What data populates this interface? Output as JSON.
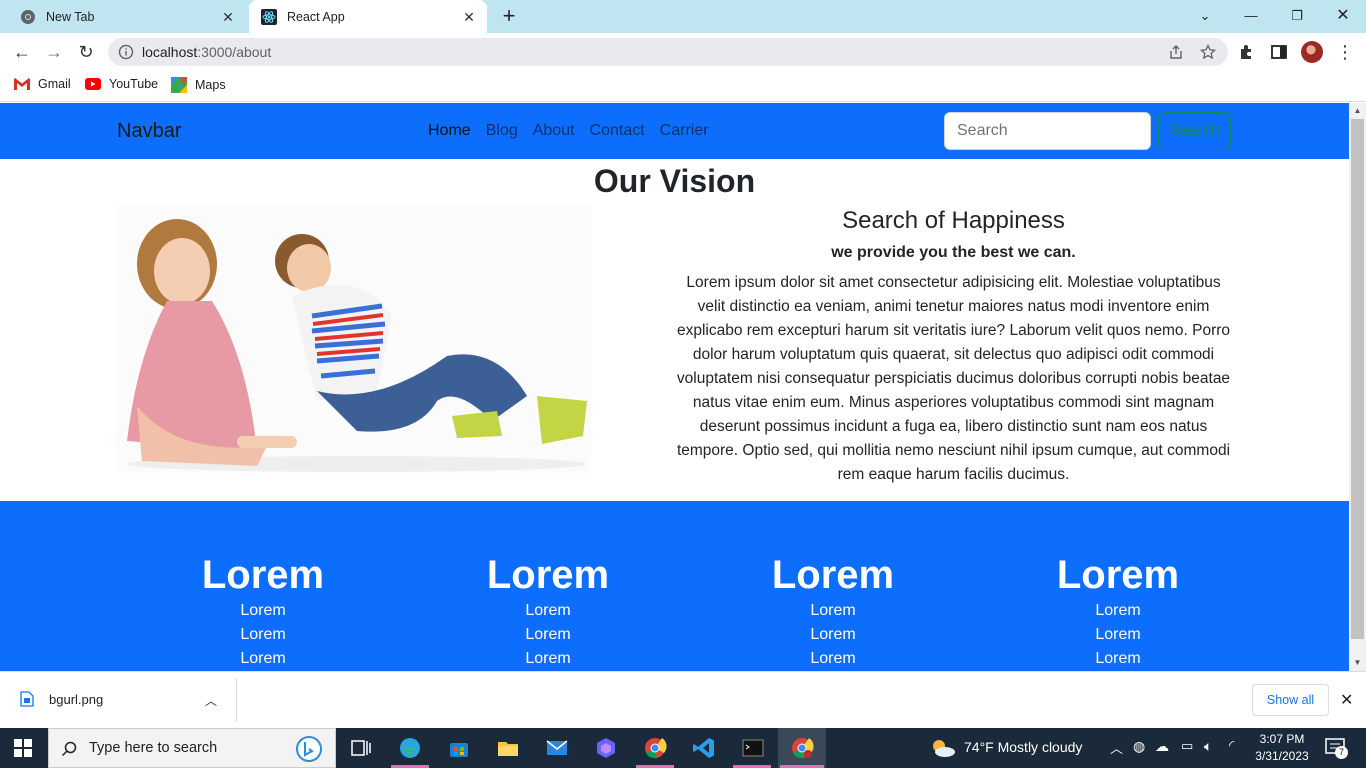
{
  "browser": {
    "tabs": [
      {
        "title": "New Tab",
        "icon": "chrome-icon",
        "active": false
      },
      {
        "title": "React App",
        "icon": "react-icon",
        "active": true
      }
    ],
    "url_host": "localhost",
    "url_path": ":3000/about",
    "bookmarks": [
      {
        "label": "Gmail",
        "icon": "gmail-icon"
      },
      {
        "label": "YouTube",
        "icon": "youtube-icon"
      },
      {
        "label": "Maps",
        "icon": "maps-icon"
      }
    ]
  },
  "page": {
    "navbar": {
      "brand": "Navbar",
      "links": [
        "Home",
        "Blog",
        "About",
        "Contact",
        "Carrier"
      ],
      "active_link": "Home",
      "search_placeholder": "Search",
      "search_button": "Search"
    },
    "vision_title": "Our Vision",
    "section_title": "Search of Happiness",
    "section_subtitle": "we provide you the best we can.",
    "paragraph": "Lorem ipsum dolor sit amet consectetur adipisicing elit. Molestiae voluptatibus velit distinctio ea veniam, animi tenetur maiores natus modi inventore enim explicabo rem excepturi harum sit veritatis iure? Laborum velit quos nemo. Porro dolor harum voluptatum quis quaerat, sit delectus quo adipisci odit commodi voluptatem nisi consequatur perspiciatis ducimus doloribus corrupti nobis beatae natus vitae enim eum. Minus asperiores voluptatibus commodi sint magnam deserunt possimus incidunt a fuga ea, libero distinctio sunt nam eos natus tempore. Optio sed, qui mollitia nemo nesciunt nihil ipsum cumque, aut commodi rem eaque harum facilis ducimus.",
    "footer_columns": [
      {
        "heading": "Lorem",
        "items": [
          "Lorem",
          "Lorem",
          "Lorem"
        ]
      },
      {
        "heading": "Lorem",
        "items": [
          "Lorem",
          "Lorem",
          "Lorem"
        ]
      },
      {
        "heading": "Lorem",
        "items": [
          "Lorem",
          "Lorem",
          "Lorem"
        ]
      },
      {
        "heading": "Lorem",
        "items": [
          "Lorem",
          "Lorem",
          "Lorem"
        ]
      }
    ],
    "colors": {
      "primary": "#0d6efd",
      "success": "#198754"
    }
  },
  "downloads": {
    "file": "bgurl.png",
    "show_all": "Show all"
  },
  "taskbar": {
    "search_placeholder": "Type here to search",
    "weather": "74°F  Mostly cloudy",
    "time": "3:07 PM",
    "date": "3/31/2023",
    "notifications": "7"
  }
}
